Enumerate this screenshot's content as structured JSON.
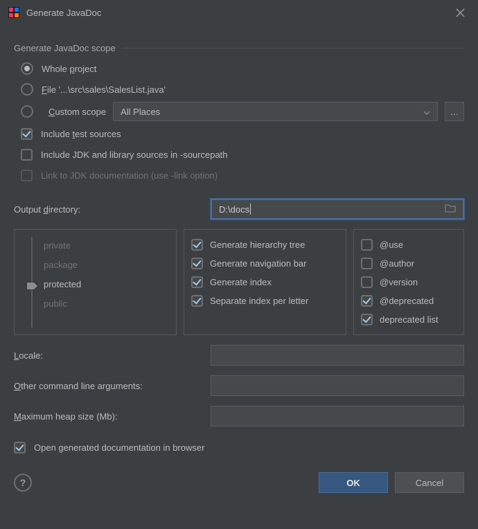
{
  "title": "Generate JavaDoc",
  "scope": {
    "header": "Generate JavaDoc scope",
    "wholeProject": "Whole project",
    "file": "File '...\\src\\sales\\SalesList.java'",
    "customScope": "Custom scope",
    "customScopeValue": "All Places",
    "browseBtn": "...",
    "includeTest": "Include test sources",
    "includeJdk": "Include JDK and library sources in -sourcepath",
    "linkJdk": "Link to JDK documentation (use -link option)"
  },
  "output": {
    "label": "Output directory:",
    "value": "D:\\docs"
  },
  "visibility": {
    "private": "private",
    "package": "package",
    "protected": "protected",
    "public": "public"
  },
  "midOptions": {
    "hierarchy": "Generate hierarchy tree",
    "navbar": "Generate navigation bar",
    "index": "Generate index",
    "separate": "Separate index per letter"
  },
  "rightOptions": {
    "use": "@use",
    "author": "@author",
    "version": "@version",
    "deprecated": "@deprecated",
    "deprecatedList": "deprecated list"
  },
  "fields": {
    "locale": "Locale:",
    "otherArgs": "Other command line arguments:",
    "heapSize": "Maximum heap size (Mb):"
  },
  "openInBrowser": "Open generated documentation in browser",
  "footer": {
    "ok": "OK",
    "cancel": "Cancel"
  }
}
